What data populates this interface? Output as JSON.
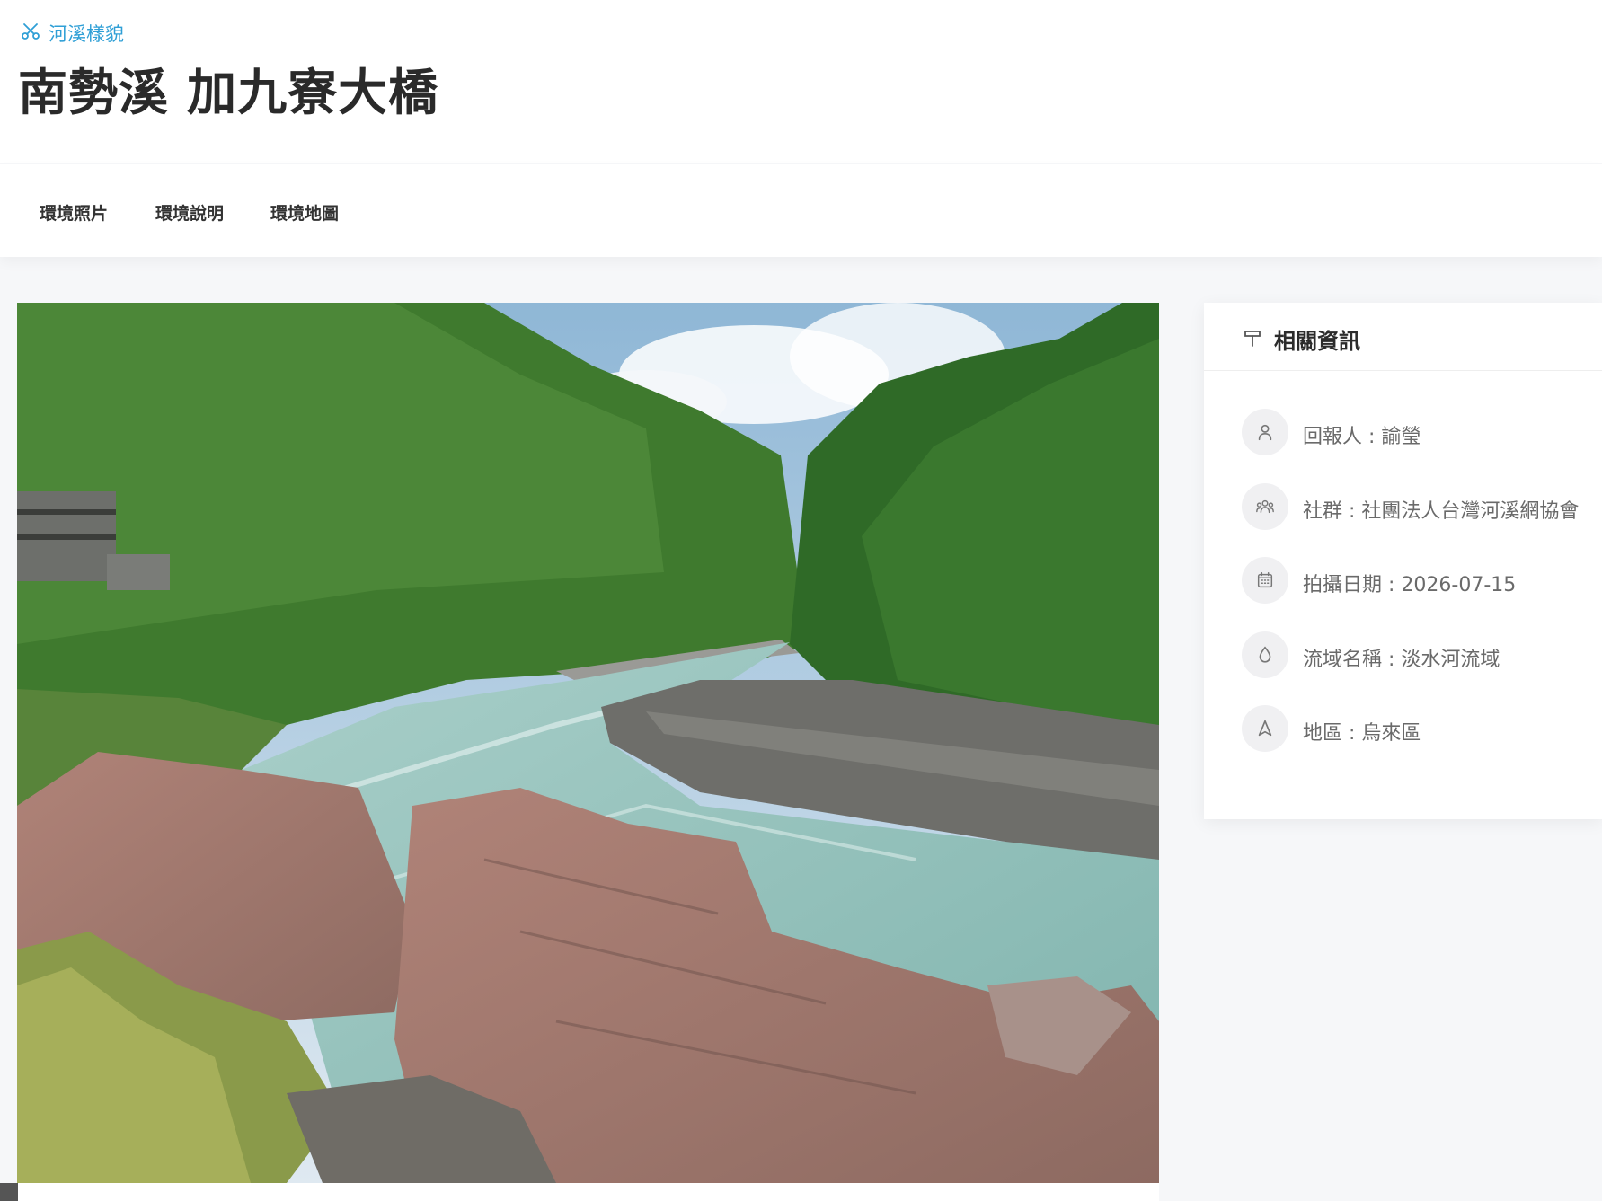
{
  "breadcrumb": {
    "label": "河溪樣貌",
    "icon": "scissors-icon",
    "color": "#2f9fd6"
  },
  "page": {
    "title": "南勢溪 加九寮大橋"
  },
  "tabs": [
    {
      "label": "環境照片"
    },
    {
      "label": "環境說明"
    },
    {
      "label": "環境地圖"
    }
  ],
  "photo": {
    "alt": "river-landscape-photo"
  },
  "info": {
    "title": "相關資訊",
    "title_icon": "signpost-icon",
    "items": [
      {
        "icon": "user-icon",
        "text": "回報人 : 諭瑩"
      },
      {
        "icon": "group-icon",
        "text": "社群 : 社團法人台灣河溪網協會"
      },
      {
        "icon": "calendar-icon",
        "text": "拍攝日期 : 2026-07-15"
      },
      {
        "icon": "water-drop-icon",
        "text": "流域名稱 : 淡水河流域"
      },
      {
        "icon": "navigation-icon",
        "text": "地區 : 烏來區"
      }
    ]
  }
}
